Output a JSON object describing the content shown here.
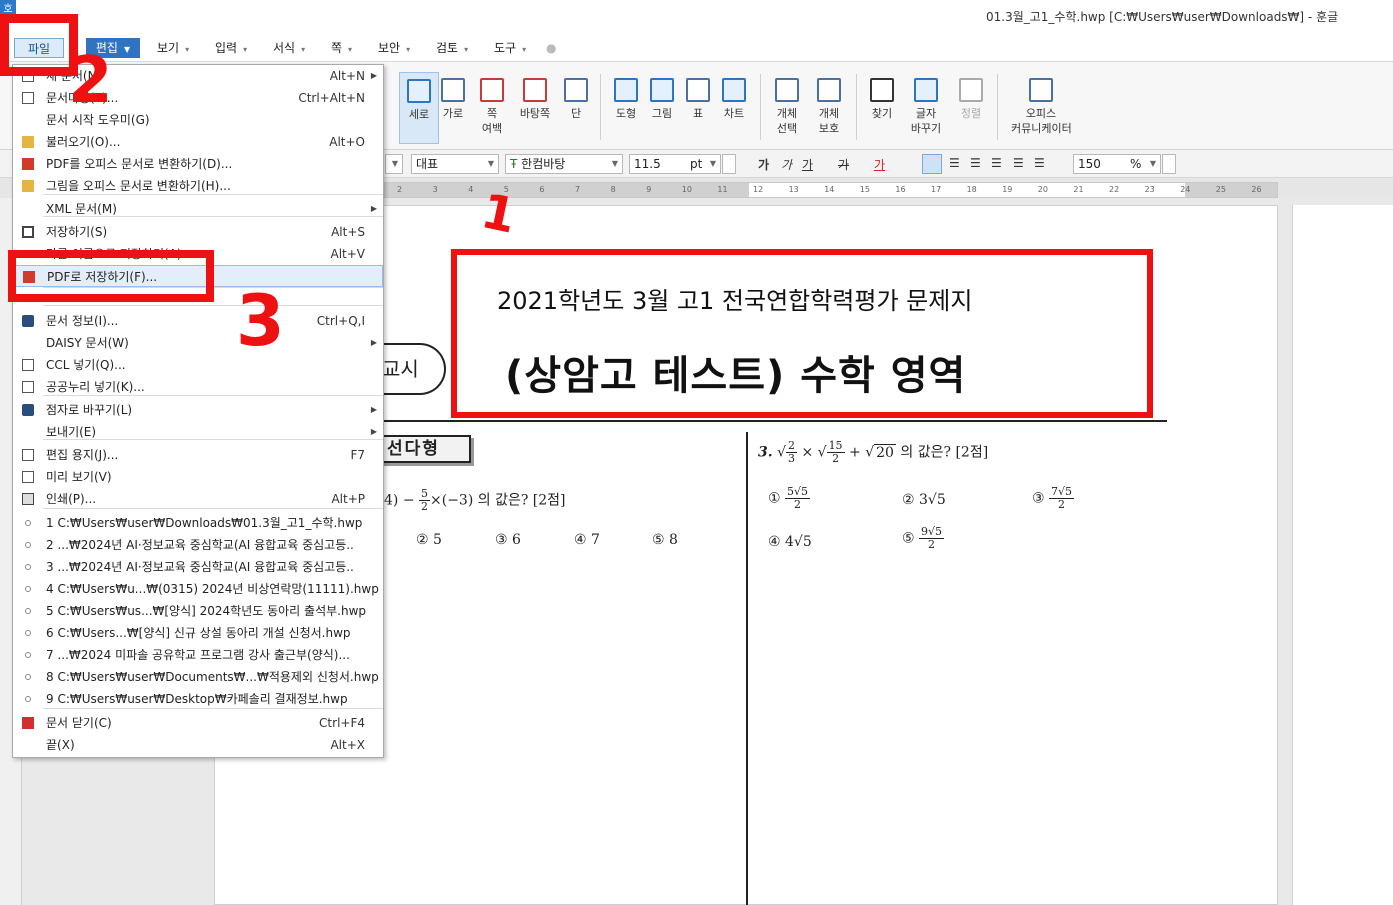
{
  "window": {
    "app_icon": "호",
    "title": "01.3월_고1_수학.hwp [C:₩Users₩user₩Downloads₩] - 훈글"
  },
  "menubar": {
    "items": [
      {
        "label": "파일"
      },
      {
        "label": "편집"
      },
      {
        "label": "보기"
      },
      {
        "label": "입력"
      },
      {
        "label": "서식"
      },
      {
        "label": "쪽"
      },
      {
        "label": "보안"
      },
      {
        "label": "검토"
      },
      {
        "label": "도구"
      }
    ]
  },
  "toolbar": {
    "buttons": [
      {
        "label": "세로",
        "icon": "portrait-page-icon"
      },
      {
        "label": "가로",
        "icon": "landscape-page-icon"
      },
      {
        "label": "쪽",
        "label2": "여백",
        "icon": "page-margin-icon"
      },
      {
        "label": "바탕쪽",
        "icon": "master-page-icon"
      },
      {
        "label": "단",
        "icon": "columns-icon"
      },
      {
        "label": "도형",
        "icon": "shape-icon"
      },
      {
        "label": "그림",
        "icon": "picture-icon"
      },
      {
        "label": "표",
        "icon": "table-icon"
      },
      {
        "label": "차트",
        "icon": "chart-icon"
      },
      {
        "label": "개체",
        "label2": "선택",
        "icon": "object-select-icon"
      },
      {
        "label": "개체",
        "label2": "보호",
        "icon": "object-protect-icon"
      },
      {
        "label": "찾기",
        "icon": "binoculars-icon"
      },
      {
        "label": "글자",
        "label2": "바꾸기",
        "icon": "replace-text-icon"
      },
      {
        "label": "정렬",
        "icon": "sort-icon"
      },
      {
        "label": "오피스",
        "label2": "커뮤니케이터",
        "icon": "office-communicator-icon"
      }
    ]
  },
  "formatbar": {
    "style": "대표",
    "font": "한컴바탕",
    "font_size": "11.5",
    "unit": "pt",
    "zoom": "150",
    "zoom_unit": "%",
    "bold": "가",
    "italic": "가",
    "underline": "가",
    "strike": "가",
    "color": "가"
  },
  "ruler": {
    "ticks": [
      "2",
      "3",
      "4",
      "5",
      "6",
      "7",
      "8",
      "9",
      "10",
      "11",
      "12",
      "13",
      "14",
      "15",
      "16",
      "17",
      "18",
      "19",
      "20",
      "21",
      "22",
      "23",
      "24",
      "25",
      "26"
    ]
  },
  "file_menu": {
    "items": [
      {
        "label": "새 문서(N)",
        "shortcut": "Alt+N",
        "submenu": true,
        "icon": "new-doc-icon"
      },
      {
        "label": "문서마당(T)...",
        "shortcut": "Ctrl+Alt+N",
        "icon": "template-icon"
      },
      {
        "label": "문서 시작 도우미(G)",
        "shortcut": "",
        "icon": ""
      },
      {
        "label": "불러오기(O)...",
        "shortcut": "Alt+O",
        "icon": "open-folder-icon"
      },
      {
        "label": "PDF를 오피스 문서로 변환하기(D)...",
        "shortcut": "",
        "icon": "pdf-icon"
      },
      {
        "label": "그림을 오피스 문서로 변환하기(H)...",
        "shortcut": "",
        "icon": "image-convert-icon"
      },
      {
        "label": "XML 문서(M)",
        "shortcut": "",
        "submenu": true,
        "icon": ""
      },
      {
        "label": "저장하기(S)",
        "shortcut": "Alt+S",
        "icon": "save-icon"
      },
      {
        "label": "다른 이름으로 저장하기(A)...",
        "shortcut": "Alt+V",
        "icon": ""
      },
      {
        "label": "PDF로 저장하기(F)...",
        "shortcut": "",
        "icon": "pdf-save-icon"
      },
      {
        "label": "문서 정보(I)...",
        "shortcut": "Ctrl+Q,I",
        "icon": "info-icon"
      },
      {
        "label": "DAISY 문서(W)",
        "shortcut": "",
        "submenu": true,
        "icon": ""
      },
      {
        "label": "CCL 넣기(Q)...",
        "shortcut": "",
        "icon": "ccl-icon"
      },
      {
        "label": "공공누리 넣기(K)...",
        "shortcut": "",
        "icon": "open-license-icon"
      },
      {
        "label": "점자로 바꾸기(L)",
        "shortcut": "",
        "submenu": true,
        "icon": "braille-icon"
      },
      {
        "label": "보내기(E)",
        "shortcut": "",
        "submenu": true,
        "icon": ""
      },
      {
        "label": "편집 용지(J)...",
        "shortcut": "F7",
        "icon": "page-setup-icon"
      },
      {
        "label": "미리 보기(V)",
        "shortcut": "",
        "icon": "preview-icon"
      },
      {
        "label": "인쇄(P)...",
        "shortcut": "Alt+P",
        "icon": "print-icon"
      },
      {
        "label": "1 C:₩Users₩user₩Downloads₩01.3월_고1_수학.hwp",
        "shortcut": "",
        "icon": "recent-icon"
      },
      {
        "label": "2 ...₩2024년 AI·정보교육 중심학교(AI 융합교육 중심고등..",
        "shortcut": "",
        "icon": "recent-icon"
      },
      {
        "label": "3 ...₩2024년 AI·정보교육 중심학교(AI 융합교육 중심고등..",
        "shortcut": "",
        "icon": "recent-icon"
      },
      {
        "label": "4 C:₩Users₩u...₩(0315) 2024년 비상연락망(11111).hwp",
        "shortcut": "",
        "icon": "recent-icon"
      },
      {
        "label": "5 C:₩Users₩us...₩[양식] 2024학년도 동아리 출석부.hwp",
        "shortcut": "",
        "icon": "recent-icon"
      },
      {
        "label": "6 C:₩Users...₩[양식] 신규 상설 동아리 개설 신청서.hwp",
        "shortcut": "",
        "icon": "recent-icon"
      },
      {
        "label": "7 ...₩2024 미파솔 공유학교 프로그램 강사 출근부(양식)...",
        "shortcut": "",
        "icon": "recent-icon"
      },
      {
        "label": "8 C:₩Users₩user₩Documents₩...₩적용제외 신청서.hwp",
        "shortcut": "",
        "icon": "recent-icon"
      },
      {
        "label": "9 C:₩Users₩user₩Desktop₩카페솔리 결재정보.hwp",
        "shortcut": "",
        "icon": "recent-icon"
      },
      {
        "label": "문서 닫기(C)",
        "shortcut": "Ctrl+F4",
        "icon": "close-doc-icon"
      },
      {
        "label": "끝(X)",
        "shortcut": "Alt+X",
        "icon": ""
      }
    ]
  },
  "document": {
    "title_line1": "2021학년도 3월 고1 전국연합학력평가 문제지",
    "title_line2": "(상암고 테스트) 수학 영역",
    "period": "교시",
    "section": "선다형",
    "q2_text": "4) − ",
    "q2_tail": "×(−3) 의 값은? [2점]",
    "q2_frac_num": "5",
    "q2_frac_den": "2",
    "q2_options": [
      "② 5",
      "③ 6",
      "④ 7",
      "⑤ 8"
    ],
    "q3_num": "3.",
    "q3_tail": "의 값은? [2점]",
    "q3_options": [
      "①",
      "② 3√5",
      "③",
      "④ 4√5",
      "⑤"
    ]
  },
  "annotations": {
    "step1": "1",
    "step2": "2",
    "step3": "3"
  }
}
